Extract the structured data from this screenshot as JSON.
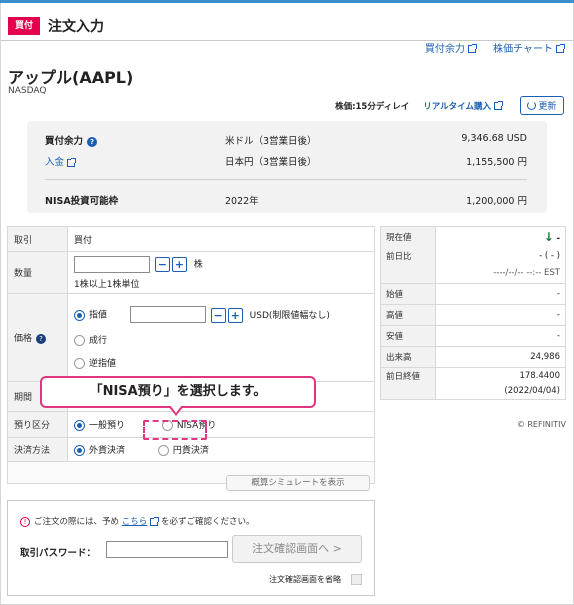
{
  "header": {
    "badge": "買付",
    "title": "注文入力",
    "links": [
      "買付余力",
      "株価チャート"
    ]
  },
  "stock": {
    "name": "アップル(AAPL)",
    "exchange": "NASDAQ",
    "delay_note": "株価:15分ディレイ",
    "realtime_link": "リアルタイム購入",
    "refresh_label": "更新"
  },
  "balance": {
    "buying_power_label": "買付余力",
    "deposit_link": "入金",
    "rows": [
      {
        "sub": "米ドル（3営業日後）",
        "value": "9,346.68 USD"
      },
      {
        "sub": "日本円（3営業日後）",
        "value": "1,155,500 円"
      }
    ],
    "nisa_label": "NISA投資可能枠",
    "nisa_year": "2022年",
    "nisa_value": "1,200,000 円"
  },
  "order": {
    "trade_label": "取引",
    "trade_value": "買付",
    "qty_label": "数量",
    "qty_value": "",
    "qty_unit": "株",
    "qty_note": "1株以上1株単位",
    "price_label": "価格",
    "price_type_limit": "指値",
    "price_value": "",
    "price_unit": "USD(制限値幅なし)",
    "price_type_market": "成行",
    "price_type_trailing": "逆指値",
    "period_label": "期間",
    "account_label": "預り区分",
    "account_general": "一般預り",
    "account_nisa": "NISA預り",
    "settle_label": "決済方法",
    "settle_foreign": "外貨決済",
    "settle_yen": "円貨決済",
    "simulate_button": "概算シミュレートを表示"
  },
  "quote": {
    "rows": [
      {
        "label": "現在値",
        "value": "-"
      },
      {
        "label": "前日比",
        "value": "- ( - )"
      },
      {
        "label": "",
        "value": "----/--/-- --:-- EST"
      },
      {
        "label": "始値",
        "value": "-"
      },
      {
        "label": "高値",
        "value": "-"
      },
      {
        "label": "安値",
        "value": "-"
      },
      {
        "label": "出来高",
        "value": "24,986"
      },
      {
        "label": "前日終値",
        "value": "178.4400"
      },
      {
        "label": "",
        "value": "(2022/04/04)"
      }
    ],
    "source": "© REFINITIV"
  },
  "confirm": {
    "notice_prefix": "ご注文の際には、予め",
    "notice_link": "こちら",
    "notice_suffix": "を必ずご確認ください。",
    "password_label": "取引パスワード：",
    "password_value": "",
    "confirm_button": "注文確認画面へ >",
    "skip_label": "注文確認画面を省略"
  },
  "callout": {
    "text": "「NISA預り」を選択します。"
  },
  "colors": {
    "accent_blue": "#1a5fb4",
    "badge_red": "#e5004f",
    "highlight_pink": "#e03580",
    "panel_gray": "#f2f2f2"
  }
}
